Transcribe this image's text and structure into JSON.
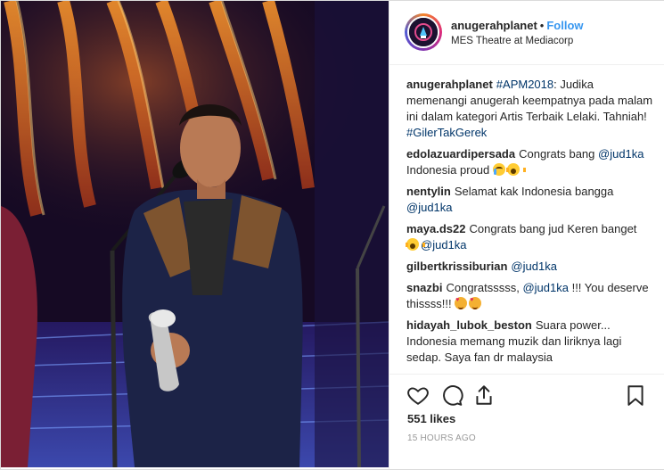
{
  "post": {
    "username": "anugerahplanet",
    "separator": "•",
    "follow_label": "Follow",
    "location": "MES Theatre at Mediacorp"
  },
  "caption": {
    "username": "anugerahplanet",
    "hashtag1": "#APM2018",
    "text": ": Judika memenangi anugerah keempatnya pada malam ini dalam kategori Artis Terbaik Lelaki. Tahniah!",
    "hashtag2": "#GilerTakGerek"
  },
  "comments": [
    {
      "user": "edolazuardipersada",
      "pre": "Congrats bang ",
      "mention": "@jud1ka",
      "post": " Indonesia proud",
      "emojis": [
        "crying-face",
        "screaming-face"
      ]
    },
    {
      "user": "nentylin",
      "pre": "Selamat kak Indonesia bangga ",
      "mention": "@jud1ka",
      "post": "",
      "emojis": []
    },
    {
      "user": "maya.ds22",
      "pre": "Congrats bang jud Keren banget ",
      "mention": "@jud1ka",
      "post": "",
      "emojis": [
        "screaming-face"
      ],
      "emoji_first": true
    },
    {
      "user": "gilbertkrissiburian",
      "pre": "",
      "mention": "@jud1ka",
      "post": "",
      "emojis": []
    },
    {
      "user": "snazbi",
      "pre": "Congratsssss, ",
      "mention": "@jud1ka",
      "post": " !!! You deserve thissss!!!",
      "emojis": [
        "heart-eyes-face",
        "heart-eyes-face"
      ]
    },
    {
      "user": "hidayah_lubok_beston",
      "pre": "Suara power... Indonesia memang muzik dan liriknya lagi sedap. Saya fan dr malaysia",
      "mention": "",
      "post": "",
      "emojis": []
    }
  ],
  "likes": "551 likes",
  "timestamp": "15 HOURS AGO",
  "icons": {
    "like": "heart-outline-icon",
    "comment": "comment-bubble-icon",
    "share": "share-icon",
    "save": "bookmark-icon"
  },
  "colors": {
    "link": "#003569",
    "follow": "#3897f0",
    "text": "#262626",
    "muted": "#999999"
  }
}
